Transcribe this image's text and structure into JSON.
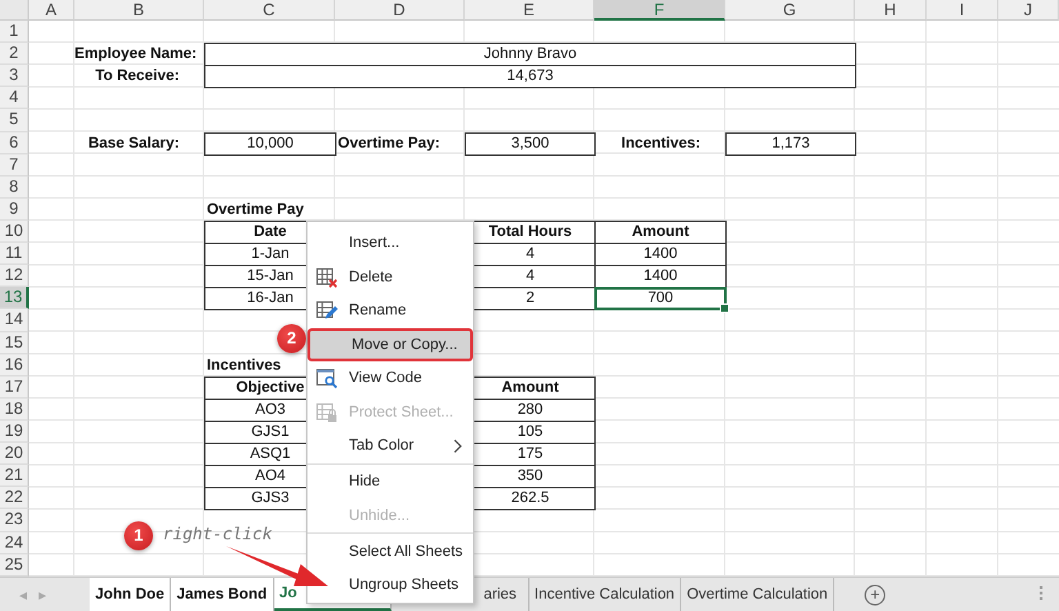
{
  "columns": [
    {
      "label": "A",
      "selected": false
    },
    {
      "label": "B",
      "selected": false
    },
    {
      "label": "C",
      "selected": false
    },
    {
      "label": "D",
      "selected": false
    },
    {
      "label": "E",
      "selected": false
    },
    {
      "label": "F",
      "selected": true
    },
    {
      "label": "G",
      "selected": false
    },
    {
      "label": "H",
      "selected": false
    },
    {
      "label": "I",
      "selected": false
    },
    {
      "label": "J",
      "selected": false
    }
  ],
  "rows": [
    {
      "label": "1",
      "selected": false
    },
    {
      "label": "2",
      "selected": false
    },
    {
      "label": "3",
      "selected": false
    },
    {
      "label": "4",
      "selected": false
    },
    {
      "label": "5",
      "selected": false
    },
    {
      "label": "6",
      "selected": false
    },
    {
      "label": "7",
      "selected": false
    },
    {
      "label": "8",
      "selected": false
    },
    {
      "label": "9",
      "selected": false
    },
    {
      "label": "10",
      "selected": false
    },
    {
      "label": "11",
      "selected": false
    },
    {
      "label": "12",
      "selected": false
    },
    {
      "label": "13",
      "selected": true
    },
    {
      "label": "14",
      "selected": false
    },
    {
      "label": "15",
      "selected": false
    },
    {
      "label": "16",
      "selected": false
    },
    {
      "label": "17",
      "selected": false
    },
    {
      "label": "18",
      "selected": false
    },
    {
      "label": "19",
      "selected": false
    },
    {
      "label": "20",
      "selected": false
    },
    {
      "label": "21",
      "selected": false
    },
    {
      "label": "22",
      "selected": false
    },
    {
      "label": "23",
      "selected": false
    },
    {
      "label": "24",
      "selected": false
    },
    {
      "label": "25",
      "selected": false
    }
  ],
  "summary": [
    {
      "label": "Employee Name:",
      "value": "Johnny Bravo"
    },
    {
      "label": "To Receive:",
      "value": "14,673"
    }
  ],
  "pay": [
    {
      "label": "Base Salary:",
      "value": "10,000"
    },
    {
      "label": "Overtime Pay:",
      "value": "3,500"
    },
    {
      "label": "Incentives:",
      "value": "1,173"
    }
  ],
  "overtime_table": {
    "title": "Overtime Pay",
    "columns": [
      "Date",
      "Total Hours",
      "Amount"
    ],
    "rows": [
      {
        "date": "1-Jan",
        "hours": "4",
        "amount": "1400",
        "selected": false
      },
      {
        "date": "15-Jan",
        "hours": "4",
        "amount": "1400",
        "selected": false
      },
      {
        "date": "16-Jan",
        "hours": "2",
        "amount": "700",
        "selected": true
      }
    ]
  },
  "incentives_table": {
    "title": "Incentives",
    "columns": [
      "Objective",
      "Amount"
    ],
    "rows": [
      {
        "objective": "AO3",
        "amount": "280"
      },
      {
        "objective": "GJS1",
        "amount": "105"
      },
      {
        "objective": "ASQ1",
        "amount": "175"
      },
      {
        "objective": "AO4",
        "amount": "350"
      },
      {
        "objective": "GJS3",
        "amount": "262.5"
      }
    ]
  },
  "context_menu": {
    "items": [
      {
        "label": "Insert...",
        "disabled": false,
        "selected": false,
        "submenu": false,
        "separator_before": false
      },
      {
        "label": "Delete",
        "disabled": false,
        "selected": false,
        "submenu": false,
        "separator_before": false
      },
      {
        "label": "Rename",
        "disabled": false,
        "selected": false,
        "submenu": false,
        "separator_before": false
      },
      {
        "label": "Move or Copy...",
        "disabled": false,
        "selected": true,
        "submenu": false,
        "separator_before": false
      },
      {
        "label": "View Code",
        "disabled": false,
        "selected": false,
        "submenu": false,
        "separator_before": false
      },
      {
        "label": "Protect Sheet...",
        "disabled": true,
        "selected": false,
        "submenu": false,
        "separator_before": false
      },
      {
        "label": "Tab Color",
        "disabled": false,
        "selected": false,
        "submenu": true,
        "separator_before": false
      },
      {
        "label": "Hide",
        "disabled": false,
        "selected": false,
        "submenu": false,
        "separator_before": true
      },
      {
        "label": "Unhide...",
        "disabled": true,
        "selected": false,
        "submenu": false,
        "separator_before": false
      },
      {
        "label": "Select All Sheets",
        "disabled": false,
        "selected": false,
        "submenu": false,
        "separator_before": true
      },
      {
        "label": "Ungroup Sheets",
        "disabled": false,
        "selected": false,
        "submenu": false,
        "separator_before": false
      }
    ]
  },
  "annotations": [
    {
      "number": "1",
      "note": "right-click"
    },
    {
      "number": "2"
    }
  ],
  "sheet_nav": [
    "◂",
    "▸"
  ],
  "sheet_tabs": [
    {
      "label": "John Doe",
      "selected": true,
      "active": false
    },
    {
      "label": "James Bond",
      "selected": true,
      "active": false
    },
    {
      "label": "Jo",
      "selected": true,
      "active": true
    },
    {
      "label": "aries",
      "selected": false,
      "active": false
    },
    {
      "label": "Incentive Calculation",
      "selected": false,
      "active": false
    },
    {
      "label": "Overtime Calculation",
      "selected": false,
      "active": false
    }
  ],
  "new_sheet": "+"
}
